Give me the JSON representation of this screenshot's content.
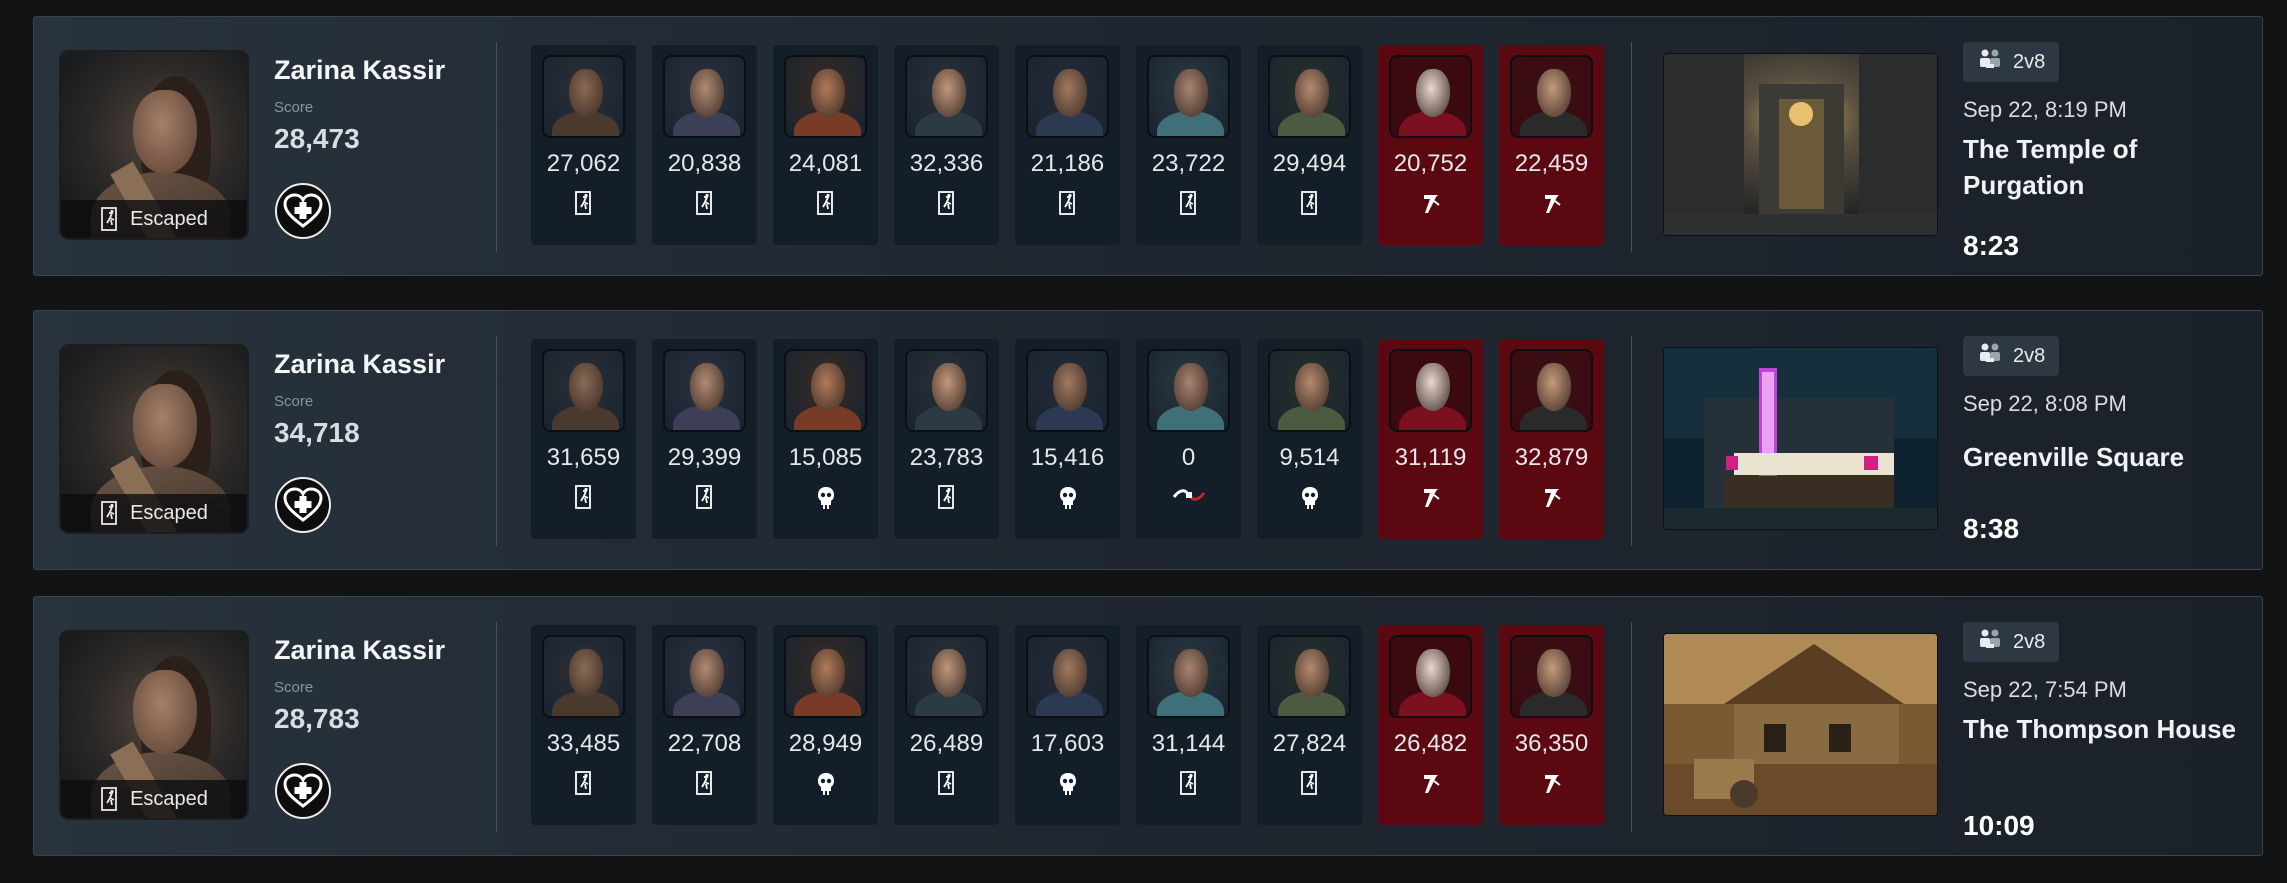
{
  "colors": {
    "background": "#121314",
    "row_panel": "#242d36",
    "survivor_card": "#131e28",
    "killer_card": "#5c0811",
    "text_primary": "#f3f5f7",
    "text_muted": "#8a949e"
  },
  "icons": {
    "escaped": "exit-door-icon",
    "sacrificed": "skull-icon",
    "disconnected": "disconnect-icon",
    "killer": "knife-icon",
    "perk": "heart-plus-icon",
    "mode": "players-icon"
  },
  "matches": [
    {
      "player": {
        "name": "Zarina Kassir",
        "score_label": "Score",
        "score": "28,473",
        "status": "Escaped"
      },
      "participants": [
        {
          "score": "27,062",
          "status": "escaped",
          "role": "survivor"
        },
        {
          "score": "20,838",
          "status": "escaped",
          "role": "survivor"
        },
        {
          "score": "24,081",
          "status": "escaped",
          "role": "survivor"
        },
        {
          "score": "32,336",
          "status": "escaped",
          "role": "survivor"
        },
        {
          "score": "21,186",
          "status": "escaped",
          "role": "survivor"
        },
        {
          "score": "23,722",
          "status": "escaped",
          "role": "survivor"
        },
        {
          "score": "29,494",
          "status": "escaped",
          "role": "survivor"
        },
        {
          "score": "20,752",
          "status": "killer",
          "role": "killer"
        },
        {
          "score": "22,459",
          "status": "killer",
          "role": "killer"
        }
      ],
      "mode": "2v8",
      "date": "Sep 22, 8:19 PM",
      "map": "The Temple of Purgation",
      "duration": "8:23"
    },
    {
      "player": {
        "name": "Zarina Kassir",
        "score_label": "Score",
        "score": "34,718",
        "status": "Escaped"
      },
      "participants": [
        {
          "score": "31,659",
          "status": "escaped",
          "role": "survivor"
        },
        {
          "score": "29,399",
          "status": "escaped",
          "role": "survivor"
        },
        {
          "score": "15,085",
          "status": "sacrificed",
          "role": "survivor"
        },
        {
          "score": "23,783",
          "status": "escaped",
          "role": "survivor"
        },
        {
          "score": "15,416",
          "status": "sacrificed",
          "role": "survivor"
        },
        {
          "score": "0",
          "status": "disconnected",
          "role": "survivor"
        },
        {
          "score": "9,514",
          "status": "sacrificed",
          "role": "survivor"
        },
        {
          "score": "31,119",
          "status": "killer",
          "role": "killer"
        },
        {
          "score": "32,879",
          "status": "killer",
          "role": "killer"
        }
      ],
      "mode": "2v8",
      "date": "Sep 22, 8:08 PM",
      "map": "Greenville Square",
      "duration": "8:38"
    },
    {
      "player": {
        "name": "Zarina Kassir",
        "score_label": "Score",
        "score": "28,783",
        "status": "Escaped"
      },
      "participants": [
        {
          "score": "33,485",
          "status": "escaped",
          "role": "survivor"
        },
        {
          "score": "22,708",
          "status": "escaped",
          "role": "survivor"
        },
        {
          "score": "28,949",
          "status": "sacrificed",
          "role": "survivor"
        },
        {
          "score": "26,489",
          "status": "escaped",
          "role": "survivor"
        },
        {
          "score": "17,603",
          "status": "sacrificed",
          "role": "survivor"
        },
        {
          "score": "31,144",
          "status": "escaped",
          "role": "survivor"
        },
        {
          "score": "27,824",
          "status": "escaped",
          "role": "survivor"
        },
        {
          "score": "26,482",
          "status": "killer",
          "role": "killer"
        },
        {
          "score": "36,350",
          "status": "killer",
          "role": "killer"
        }
      ],
      "mode": "2v8",
      "date": "Sep 22, 7:54 PM",
      "map": "The Thompson House",
      "duration": "10:09"
    }
  ]
}
